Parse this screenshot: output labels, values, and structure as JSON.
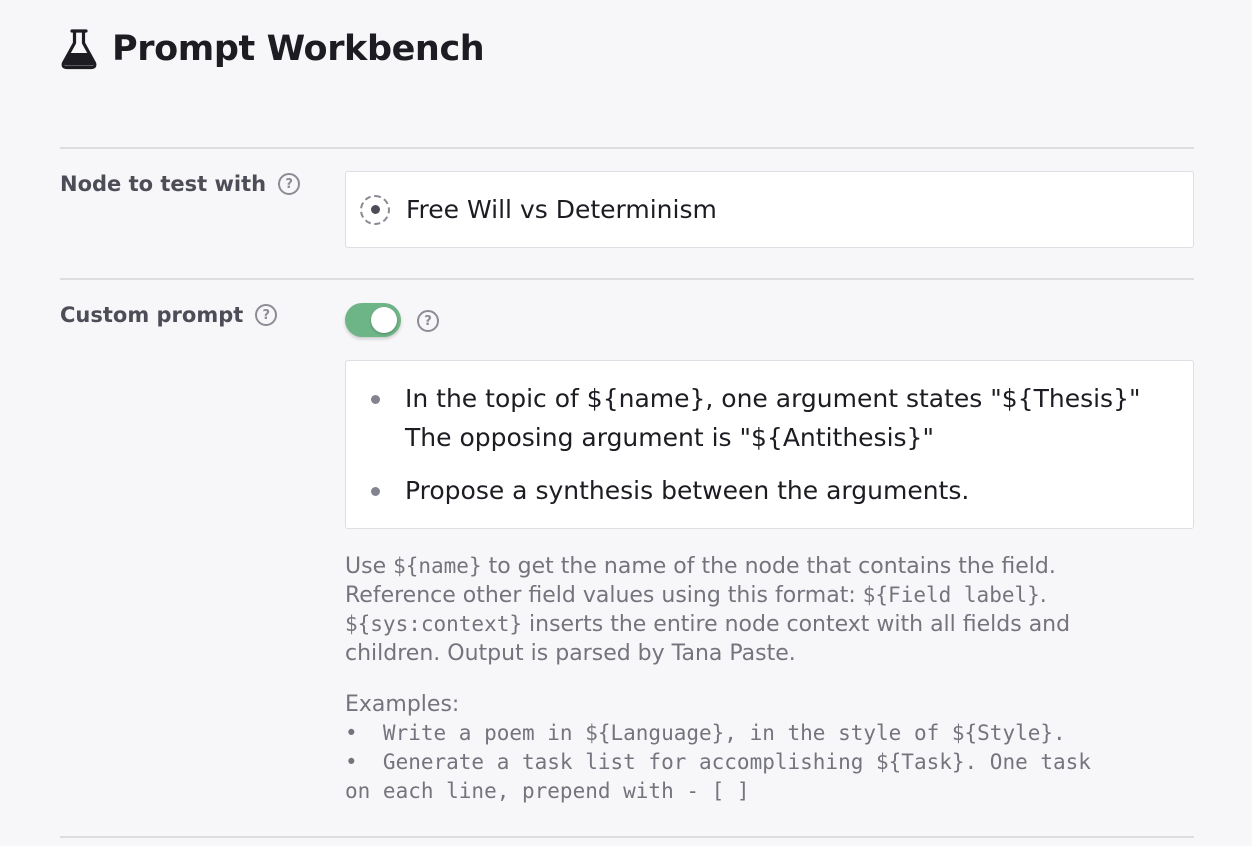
{
  "header": {
    "title": "Prompt Workbench",
    "icon": "flask-icon"
  },
  "node_field": {
    "label": "Node to test with",
    "value": "Free Will vs Determinism"
  },
  "custom_prompt": {
    "label": "Custom prompt",
    "toggle_on": true,
    "toggle_color": "#6db486",
    "items": [
      {
        "lines": [
          "In the topic of ${name}, one argument states \"${Thesis}\"",
          "The opposing argument is \"${Antithesis}\""
        ]
      },
      {
        "lines": [
          "Propose a synthesis between the arguments."
        ]
      }
    ]
  },
  "help": {
    "line1_pre": "Use ",
    "line1_code": "${name}",
    "line1_post": " to get the name of the node that contains the field.",
    "line2_pre": "Reference other field values using this format: ",
    "line2_code": "${Field label}",
    "line2_post": ".",
    "line3_code": "${sys:context}",
    "line3_post": " inserts the entire node context with all fields and",
    "line4": "children. Output is parsed by Tana Paste."
  },
  "examples": {
    "heading": "Examples:",
    "lines": [
      "•  Write a poem in ${Language}, in the style of ${Style}.",
      "•  Generate a task list for accomplishing ${Task}. One task",
      "on each line, prepend with - [ ]"
    ]
  }
}
